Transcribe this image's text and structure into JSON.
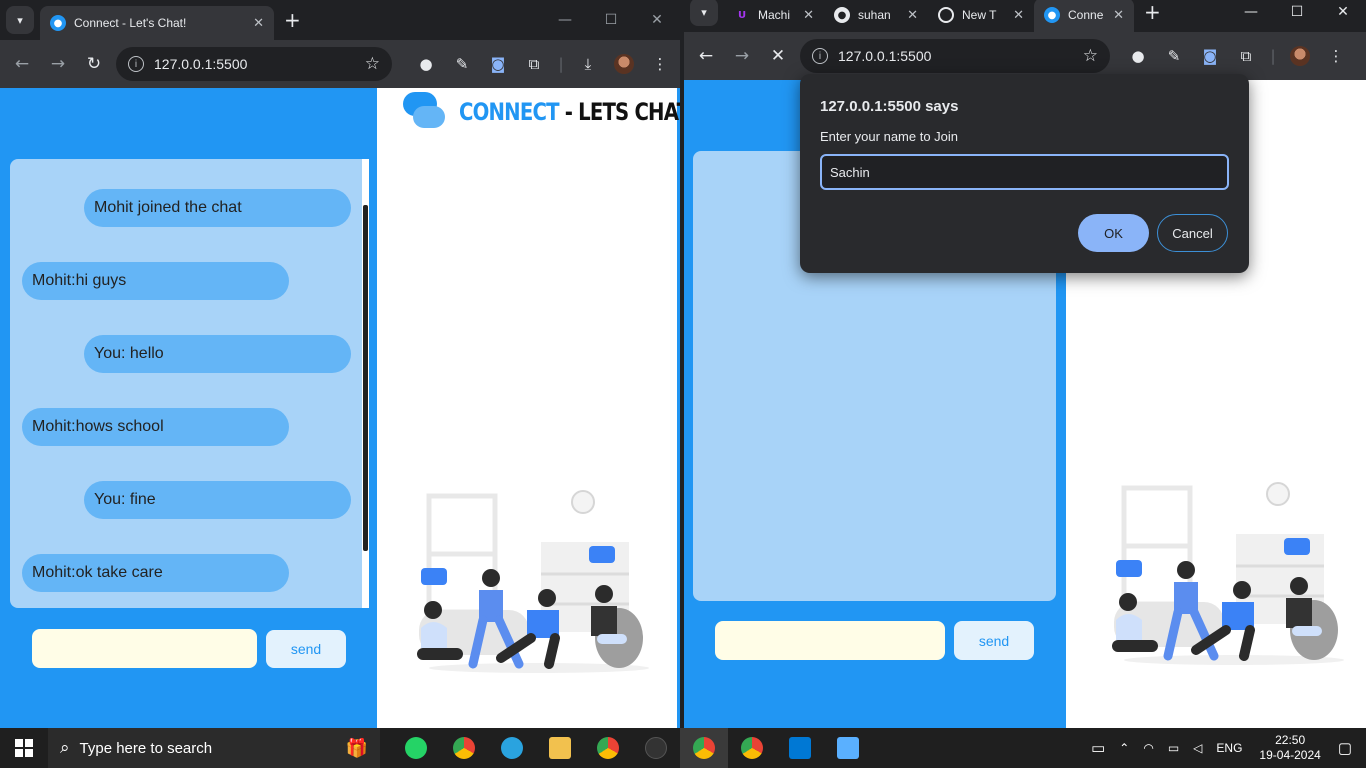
{
  "left_window": {
    "tab_title": "Connect - Let's Chat!",
    "url": "127.0.0.1:5500",
    "messages": [
      {
        "text": "Mohit joined the chat",
        "side": "right"
      },
      {
        "text": "Mohit:hi guys",
        "side": "left"
      },
      {
        "text": "You: hello",
        "side": "right"
      },
      {
        "text": "Mohit:hows school",
        "side": "left"
      },
      {
        "text": "You: fine",
        "side": "right"
      },
      {
        "text": "Mohit:ok take care",
        "side": "left"
      }
    ],
    "send_label": "send",
    "message_input_value": ""
  },
  "right_window": {
    "tabs": [
      {
        "title": "Machi",
        "icon": "udemy-icon"
      },
      {
        "title": "suhan",
        "icon": "github-icon"
      },
      {
        "title": "New T",
        "icon": "chrome-icon"
      },
      {
        "title": "Conne",
        "icon": "chat-icon"
      }
    ],
    "url": "127.0.0.1:5500",
    "send_label": "send",
    "dialog": {
      "title": "127.0.0.1:5500 says",
      "message": "Enter your name to Join",
      "input_value": "Sachin",
      "ok_label": "OK",
      "cancel_label": "Cancel"
    }
  },
  "logo": {
    "word1": "CONNECT",
    "word2": " - LETS CHAT!"
  },
  "taskbar": {
    "search_placeholder": "Type here to search",
    "language": "ENG",
    "time": "22:50",
    "date": "19-04-2024"
  },
  "colors": {
    "page_blue": "#2196f3",
    "chat_bg": "#a8d3f8",
    "bubble": "#64b5f6",
    "input_bg": "#fffde7",
    "dialog_bg": "#292a2d",
    "ok_button": "#8ab4f8"
  }
}
